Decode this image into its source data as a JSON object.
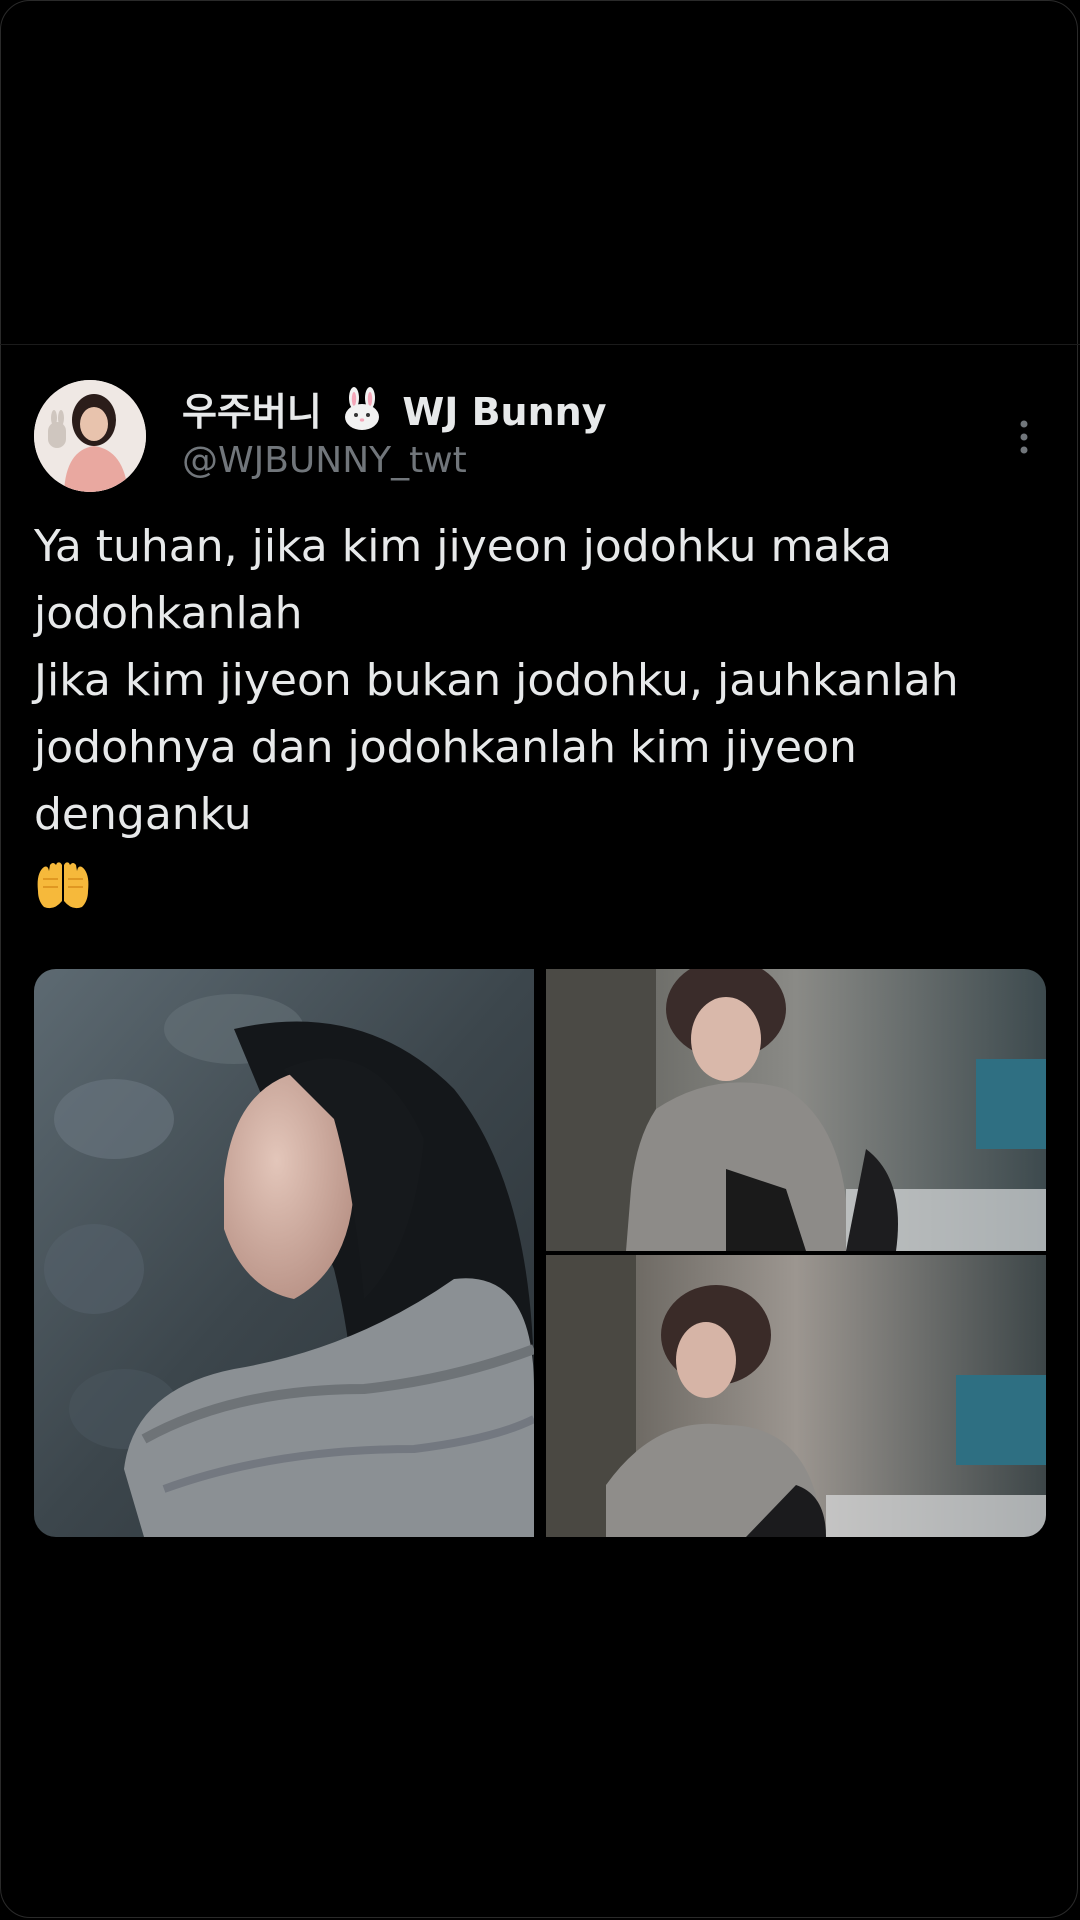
{
  "tweet": {
    "author": {
      "name_part1": "우주버니",
      "name_part2": "WJ Bunny",
      "handle": "@WJBUNNY_twt"
    },
    "text_lines": [
      "Ya tuhan, jika kim jiyeon jodohku maka",
      "jodohkanlah",
      "Jika kim jiyeon bukan jodohku, jauhkanlah",
      "jodohnya dan jodohkanlah kim jiyeon",
      "denganku"
    ],
    "emoji_icon": "raised-hands-icon",
    "media": [
      {
        "icon": "photo-portrait-closeup"
      },
      {
        "icon": "photo-portrait-scarf"
      },
      {
        "icon": "photo-portrait-scarf-2"
      }
    ]
  },
  "colors": {
    "background": "#000000",
    "text_primary": "#e7e9ea",
    "text_secondary": "#71767b"
  }
}
